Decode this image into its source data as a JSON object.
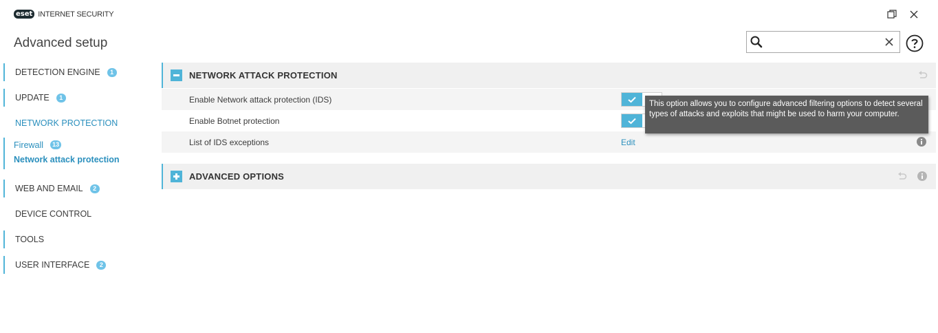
{
  "app": {
    "logo_badge": "eset",
    "logo_text": "INTERNET SECURITY",
    "page_title": "Advanced setup"
  },
  "search": {
    "value": "",
    "placeholder": ""
  },
  "sidebar": {
    "items": [
      {
        "label": "DETECTION ENGINE",
        "badge": "1"
      },
      {
        "label": "UPDATE",
        "badge": "1"
      },
      {
        "label": "NETWORK PROTECTION"
      },
      {
        "label": "Firewall",
        "badge": "13"
      },
      {
        "label": "Network attack protection"
      },
      {
        "label": "WEB AND EMAIL",
        "badge": "2"
      },
      {
        "label": "DEVICE CONTROL"
      },
      {
        "label": "TOOLS"
      },
      {
        "label": "USER INTERFACE",
        "badge": "2"
      }
    ]
  },
  "main": {
    "sections": [
      {
        "title": "NETWORK ATTACK PROTECTION",
        "expanded": true,
        "rows": [
          {
            "label": "Enable Network attack protection (IDS)",
            "enabled": true
          },
          {
            "label": "Enable Botnet protection",
            "enabled": true
          },
          {
            "label": "List of IDS exceptions",
            "action": "Edit"
          }
        ]
      },
      {
        "title": "ADVANCED OPTIONS",
        "expanded": false
      }
    ]
  },
  "tooltip": {
    "text": "This option allows you to configure advanced filtering options to detect several types of attacks and exploits that might be used to harm your computer."
  },
  "colors": {
    "accent": "#4fb4d8",
    "link": "#2a8fbd",
    "tooltip_bg": "#5b5b5b",
    "section_bg": "#f0f0f0"
  }
}
